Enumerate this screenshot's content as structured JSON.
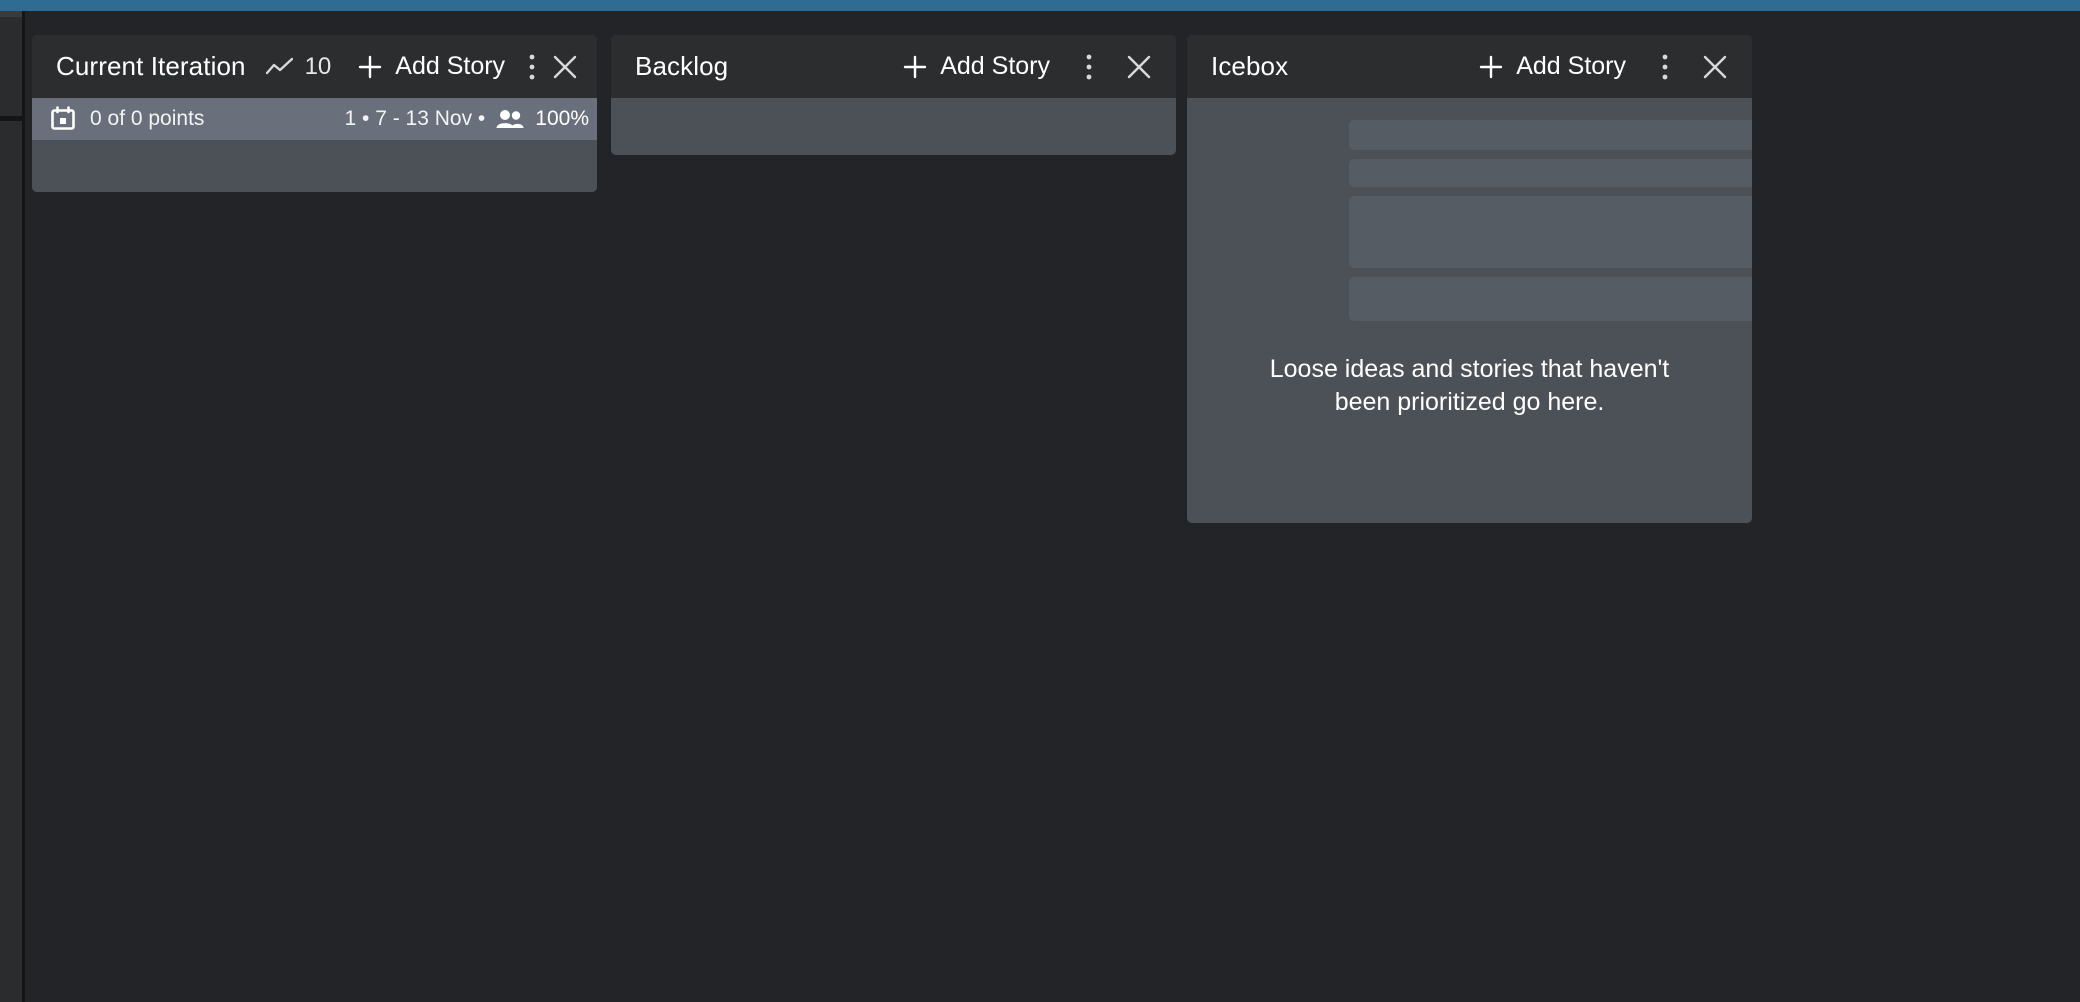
{
  "window": {
    "chrome_accent": "#2e6c94",
    "board_background": "#232427",
    "panel_background": "#2c2d2f",
    "panel_body_background": "#4c5057",
    "highlight_row_background": "#6a6f7c"
  },
  "board": {
    "panels": [
      {
        "id": "current-iteration",
        "title": "Current Iteration",
        "velocity_icon": "trend-line-icon",
        "velocity": "10",
        "add_story_label": "Add Story",
        "add_icon": "plus-icon",
        "menu_icon": "kebab-menu-icon",
        "close_icon": "close-icon",
        "iteration": {
          "calendar_icon": "calendar-icon",
          "points": "0 of 0 points",
          "meta": "1 • 7 - 13 Nov •",
          "team_icon": "people-icon",
          "percent": "100%"
        }
      },
      {
        "id": "backlog",
        "title": "Backlog",
        "add_story_label": "Add Story",
        "add_icon": "plus-icon",
        "menu_icon": "kebab-menu-icon",
        "close_icon": "close-icon"
      },
      {
        "id": "icebox",
        "title": "Icebox",
        "add_story_label": "Add Story",
        "add_icon": "plus-icon",
        "hint_line_1": "Loose ideas and stories that haven't",
        "hint_line_2": "been prioritized go here."
      }
    ]
  }
}
